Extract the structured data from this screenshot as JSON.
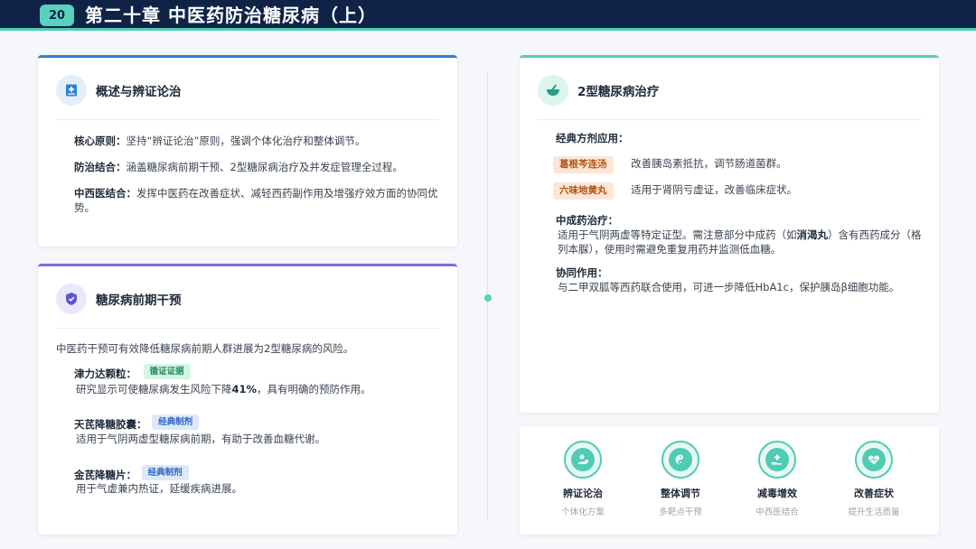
{
  "header": {
    "chapter_number": "20",
    "title": "第二十章 中医药防治糖尿病（上）"
  },
  "overview": {
    "title": "概述与辨证论治",
    "icon": "medical-book-icon",
    "items": [
      {
        "label": "核心原则：",
        "text": "坚持“辨证论治”原则，强调个体化治疗和整体调节。"
      },
      {
        "label": "防治结合：",
        "text": "涵盖糖尿病前期干预、2型糖尿病治疗及并发症管理全过程。"
      },
      {
        "label": "中西医结合：",
        "text": "发挥中医药在改善症状、减轻西药副作用及增强疗效方面的协同优势。"
      }
    ]
  },
  "prediabetes": {
    "title": "糖尿病前期干预",
    "icon": "shield-icon",
    "intro": "中医药干预可有效降低糖尿病前期人群进展为2型糖尿病的风险。",
    "drugs": [
      {
        "name": "津力达颗粒：",
        "badge": "循证证据",
        "desc_pre": "研究显示可使糖尿病发生风险下降",
        "desc_bold": "41%",
        "desc_post": "，具有明确的预防作用。"
      },
      {
        "name": "天芪降糖胶囊：",
        "badge": "经典制剂",
        "desc": "适用于气阴两虚型糖尿病前期，有助于改善血糖代谢。"
      },
      {
        "name": "金芪降糖片：",
        "badge": "经典制剂",
        "desc": "用于气虚兼内热证，延缓疾病进展。"
      }
    ]
  },
  "type2": {
    "title": "2型糖尿病治疗",
    "icon": "mortar-pestle-icon",
    "formula_heading": "经典方剂应用：",
    "formulas": [
      {
        "name": "葛根芩连汤",
        "desc": "改善胰岛素抵抗，调节肠道菌群。"
      },
      {
        "name": "六味地黄丸",
        "desc": "适用于肾阴亏虚证，改善临床症状。"
      }
    ],
    "tcm_heading": "中成药治疗：",
    "tcm_pre": "适用于气阴两虚等特定证型。需注意部分中成药（如",
    "tcm_bold": "消渴丸",
    "tcm_post": "）含有西药成分（格列本脲），使用时需避免重复用药并监测低血糖。",
    "synergy_heading": "协同作用：",
    "synergy_text": "与二甲双胍等西药联合使用，可进一步降低HbA1c，保护胰岛β细胞功能。"
  },
  "features": [
    {
      "label": "辨证论治",
      "sub": "个体化方案",
      "icon": "user-treatment-icon"
    },
    {
      "label": "整体调节",
      "sub": "多靶点干预",
      "icon": "yin-yang-icon"
    },
    {
      "label": "减毒增效",
      "sub": "中西医结合",
      "icon": "hand-care-icon"
    },
    {
      "label": "改善症状",
      "sub": "提升生活质量",
      "icon": "heart-pulse-icon"
    }
  ]
}
